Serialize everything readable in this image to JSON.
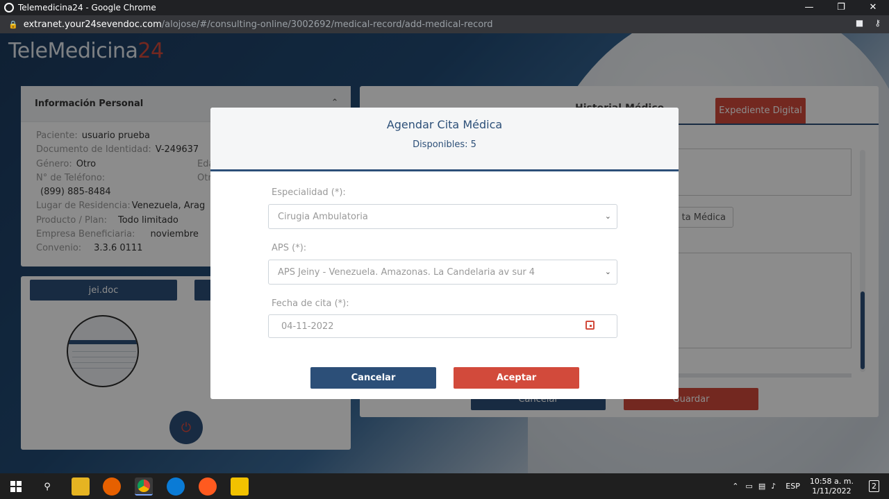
{
  "browser": {
    "window_title": "Telemedicina24 - Google Chrome",
    "url_host": "extranet.your24sevendoc.com",
    "url_path": "/alojose/#/consulting-online/3002692/medical-record/add-medical-record",
    "minimize_glyph": "—",
    "restore_glyph": "❐",
    "close_glyph": "✕"
  },
  "logo": {
    "text": "TeleMedicina",
    "num": "24"
  },
  "personal": {
    "title": "Información Personal",
    "rows": [
      {
        "label": "Paciente:",
        "value": "usuario prueba"
      },
      {
        "label": "Documento de Identidad:",
        "value": "V-249637"
      },
      {
        "label": "Género:",
        "value": "Otro",
        "extra": "Eda"
      },
      {
        "label": "N° de Teléfono:",
        "value": "",
        "extra": "Otr"
      },
      {
        "label": "",
        "value": "(899) 885-8484"
      },
      {
        "label": "Lugar de Residencia:",
        "value": "Venezuela, Arag"
      },
      {
        "label": "Producto / Plan:",
        "value": "Todo limitado"
      },
      {
        "label": "Empresa Beneficiaria:",
        "value": "noviembre"
      },
      {
        "label": "Convenio:",
        "value": "3.3.6 0111"
      }
    ]
  },
  "docs": {
    "button_label": "jei.doc"
  },
  "history": {
    "title": "Historial Médico",
    "expediente_label": "Expediente Digital",
    "cita_button_label": "ta Médica",
    "cancel_label": "Cancelar",
    "save_label": "Guardar"
  },
  "modal": {
    "title": "Agendar Cita Médica",
    "subtitle": "Disponibles: 5",
    "especialidad_label": "Especialidad (*):",
    "especialidad_value": "Cirugia Ambulatoria",
    "aps_label": "APS (*):",
    "aps_value": "APS Jeiny - Venezuela. Amazonas. La Candelaria av sur 4",
    "fecha_label": "Fecha de cita (*):",
    "fecha_value": "04-11-2022",
    "cancel_label": "Cancelar",
    "accept_label": "Aceptar"
  },
  "taskbar": {
    "language": "ESP",
    "time": "10:58 a. m.",
    "date": "1/11/2022",
    "notifications": "2"
  },
  "colors": {
    "primary": "#2c4f78",
    "accent": "#d24a3b"
  }
}
